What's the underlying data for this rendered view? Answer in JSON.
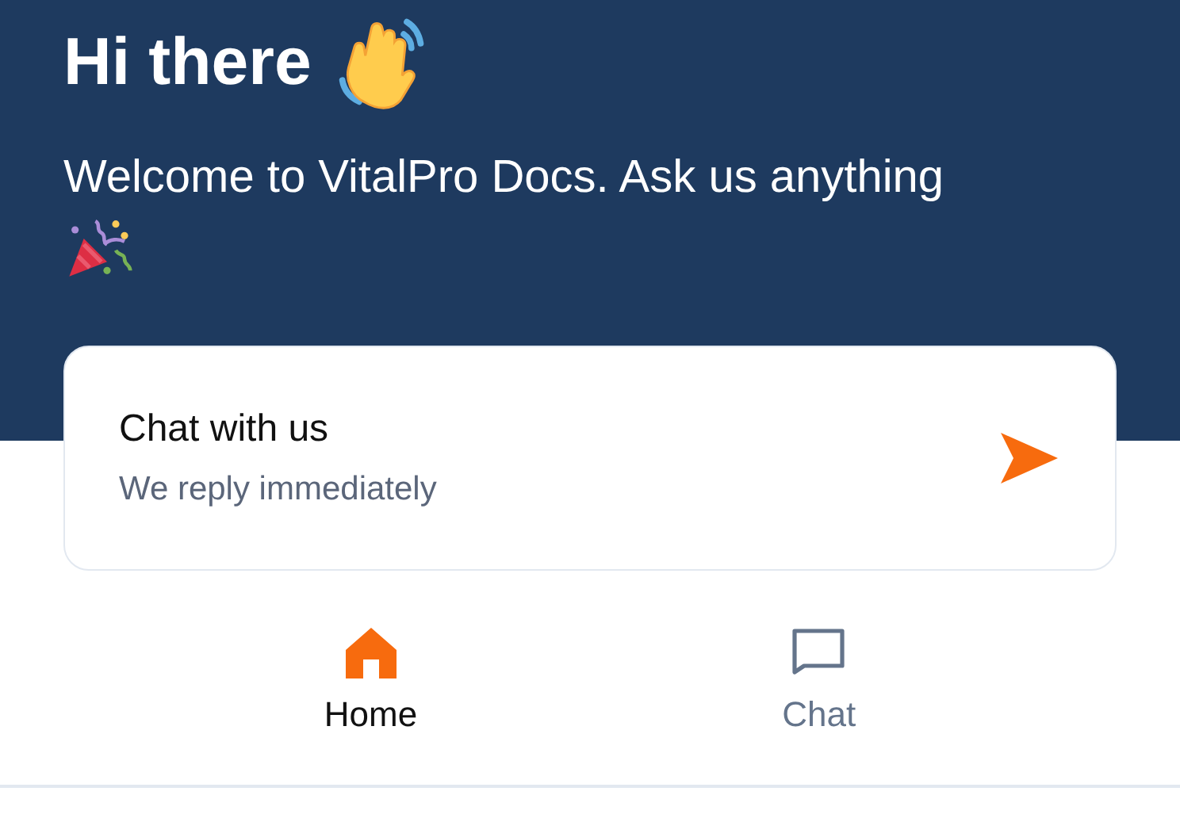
{
  "header": {
    "title": "Hi there",
    "subtitle": "Welcome to VitalPro Docs. Ask us anything"
  },
  "chat_card": {
    "title": "Chat with us",
    "subtitle": "We reply immediately"
  },
  "nav_tabs": [
    {
      "kind": "home",
      "label": "Home",
      "selected": true
    },
    {
      "kind": "chat",
      "label": "Chat",
      "selected": false
    }
  ]
}
